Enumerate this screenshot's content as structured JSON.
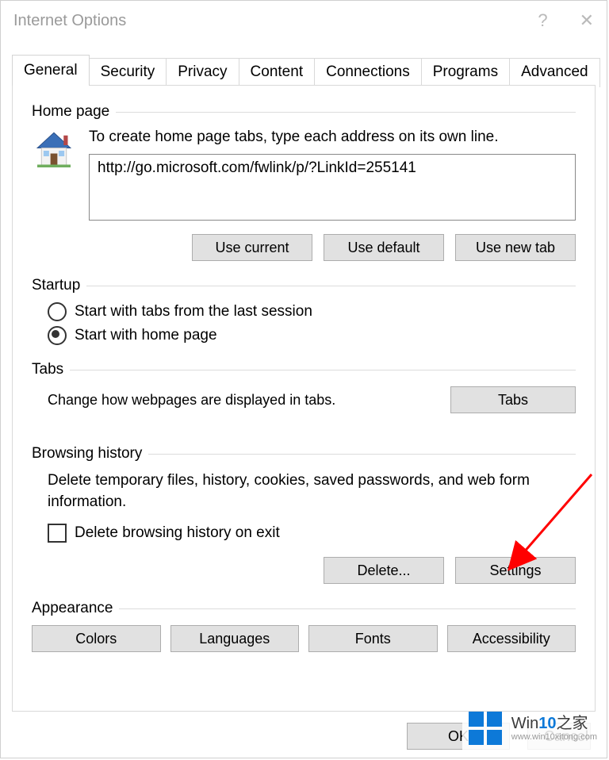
{
  "window": {
    "title": "Internet Options"
  },
  "tabs": [
    {
      "label": "General"
    },
    {
      "label": "Security"
    },
    {
      "label": "Privacy"
    },
    {
      "label": "Content"
    },
    {
      "label": "Connections"
    },
    {
      "label": "Programs"
    },
    {
      "label": "Advanced"
    }
  ],
  "home_page": {
    "title": "Home page",
    "desc": "To create home page tabs, type each address on its own line.",
    "value": "http://go.microsoft.com/fwlink/p/?LinkId=255141",
    "buttons": {
      "use_current": "Use current",
      "use_default": "Use default",
      "use_new_tab": "Use new tab"
    }
  },
  "startup": {
    "title": "Startup",
    "options": [
      {
        "label": "Start with tabs from the last session",
        "checked": false
      },
      {
        "label": "Start with home page",
        "checked": true
      }
    ]
  },
  "tabs_section": {
    "title": "Tabs",
    "desc": "Change how webpages are displayed in tabs.",
    "button": "Tabs"
  },
  "browsing": {
    "title": "Browsing history",
    "desc": "Delete temporary files, history, cookies, saved passwords, and web form information.",
    "checkbox_label": "Delete browsing history on exit",
    "checkbox_checked": false,
    "buttons": {
      "delete": "Delete...",
      "settings": "Settings"
    }
  },
  "appearance": {
    "title": "Appearance",
    "buttons": {
      "colors": "Colors",
      "languages": "Languages",
      "fonts": "Fonts",
      "accessibility": "Accessibility"
    }
  },
  "footer": {
    "ok": "OK",
    "cancel": "Cancel"
  },
  "watermark": {
    "line1_prefix": "Win",
    "line1_accent": "10",
    "line1_suffix": "之家",
    "line2": "www.win10xitong.com"
  }
}
